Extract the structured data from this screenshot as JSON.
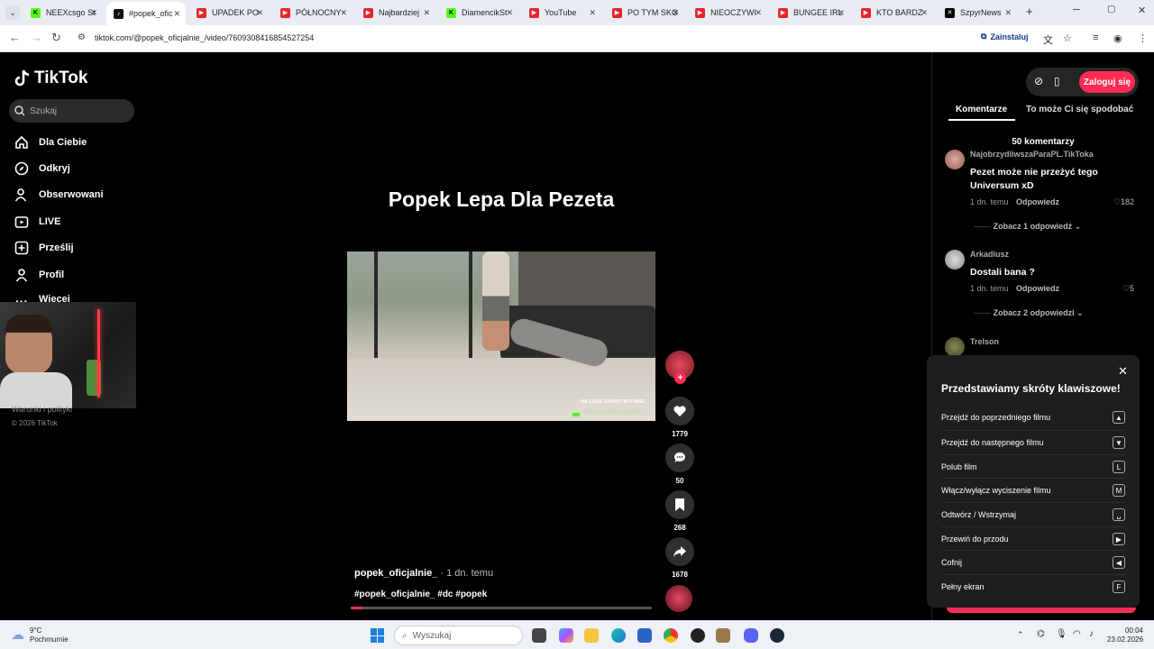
{
  "browser": {
    "tabs": [
      {
        "title": "NEEXcsgo St",
        "icon": "kick"
      },
      {
        "title": "#popek_ofic",
        "icon": "tt",
        "active": true
      },
      {
        "title": "UPADEK PO",
        "icon": "yt"
      },
      {
        "title": "PÓŁNOCNY",
        "icon": "yt"
      },
      {
        "title": "Najbardziej",
        "icon": "yt"
      },
      {
        "title": "DiamencikSt",
        "icon": "kick"
      },
      {
        "title": "YouTube",
        "icon": "yt"
      },
      {
        "title": "PO TYM SKO",
        "icon": "yt"
      },
      {
        "title": "NIEOCZYWI",
        "icon": "yt"
      },
      {
        "title": "BUNGEE IRL",
        "icon": "yt"
      },
      {
        "title": "KTO BARDZ",
        "icon": "yt"
      },
      {
        "title": "SzpyrNews",
        "icon": "x"
      }
    ],
    "url": "tiktok.com/@popek_oficjalnie_/video/7609308416854527254",
    "install_label": "Zainstaluj"
  },
  "sidebar": {
    "logo": "TikTok",
    "search_placeholder": "Szukaj",
    "items": [
      {
        "label": "Dla Ciebie",
        "icon": "home-icon"
      },
      {
        "label": "Odkryj",
        "icon": "compass-icon"
      },
      {
        "label": "Obserwowani",
        "icon": "user-icon"
      },
      {
        "label": "LIVE",
        "icon": "live-icon"
      },
      {
        "label": "Prześlij",
        "icon": "upload-icon"
      },
      {
        "label": "Profil",
        "icon": "profile-icon"
      },
      {
        "label": "Więcej",
        "icon": "more-icon"
      }
    ],
    "footer_link": "Warunki i polityki",
    "copyright": "© 2026 TikTok"
  },
  "video": {
    "title": "Popek Lepa Dla Pezeta",
    "overlay_text": "NA CELE CHARYTATYWNE",
    "overlay_sub": "1 005,13 zł / 10 000,00 zł (10.05%)",
    "author": "popek_oficjalnie_",
    "posted": "· 1 dn. temu",
    "tags": "#popek_oficjalnie_ #dc #popek",
    "progress": 0.04
  },
  "actions": {
    "likes": "1779",
    "comments": "50",
    "saves": "268",
    "shares": "1678"
  },
  "right": {
    "login_label": "Zaloguj się",
    "tab_comments": "Komentarze",
    "tab_related": "To może Ci się spodobać",
    "comment_count": "50 komentarzy",
    "comments": [
      {
        "user": "NajobrzydliwszaParaPL.TikToka",
        "text": "Pezet może nie przeżyć tego Universum xD",
        "time": "1 dn. temu",
        "reply": "Odpowiedz",
        "likes": "182",
        "more": "Zobacz 1 odpowiedź"
      },
      {
        "user": "Arkadiusz",
        "text": "Dostali bana ?",
        "time": "1 dn. temu",
        "reply": "Odpowiedz",
        "likes": "5",
        "more": "Zobacz 2 odpowiedzi"
      },
      {
        "user": "Trelson"
      }
    ]
  },
  "shortcuts": {
    "title": "Przedstawiamy skróty klawiszowe!",
    "items": [
      {
        "label": "Przejdź do poprzedniego filmu",
        "key": "▲"
      },
      {
        "label": "Przejdź do następnego filmu",
        "key": "▼"
      },
      {
        "label": "Polub film",
        "key": "L"
      },
      {
        "label": "Włącz/wyłącz wyciszenie filmu",
        "key": "M"
      },
      {
        "label": "Odtwórz / Wstrzymaj",
        "key": "␣"
      },
      {
        "label": "Przewiń do przodu",
        "key": "▶"
      },
      {
        "label": "Cofnij",
        "key": "◀"
      },
      {
        "label": "Pełny ekran",
        "key": "F"
      }
    ]
  },
  "taskbar": {
    "temp": "9°C",
    "weather": "Pochmurnie",
    "search_placeholder": "Wyszukaj",
    "time": "00:04",
    "date": "23.02.2026"
  }
}
